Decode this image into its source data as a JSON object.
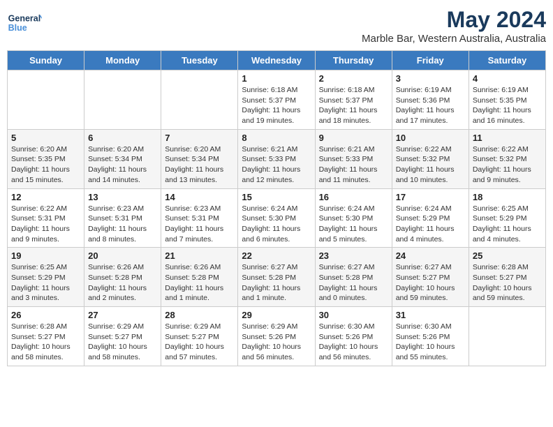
{
  "app": {
    "name_line1": "General",
    "name_line2": "Blue"
  },
  "title": {
    "month_year": "May 2024",
    "location": "Marble Bar, Western Australia, Australia"
  },
  "days_of_week": [
    "Sunday",
    "Monday",
    "Tuesday",
    "Wednesday",
    "Thursday",
    "Friday",
    "Saturday"
  ],
  "weeks": [
    [
      {
        "day": "",
        "text": ""
      },
      {
        "day": "",
        "text": ""
      },
      {
        "day": "",
        "text": ""
      },
      {
        "day": "1",
        "text": "Sunrise: 6:18 AM\nSunset: 5:37 PM\nDaylight: 11 hours and 19 minutes."
      },
      {
        "day": "2",
        "text": "Sunrise: 6:18 AM\nSunset: 5:37 PM\nDaylight: 11 hours and 18 minutes."
      },
      {
        "day": "3",
        "text": "Sunrise: 6:19 AM\nSunset: 5:36 PM\nDaylight: 11 hours and 17 minutes."
      },
      {
        "day": "4",
        "text": "Sunrise: 6:19 AM\nSunset: 5:35 PM\nDaylight: 11 hours and 16 minutes."
      }
    ],
    [
      {
        "day": "5",
        "text": "Sunrise: 6:20 AM\nSunset: 5:35 PM\nDaylight: 11 hours and 15 minutes."
      },
      {
        "day": "6",
        "text": "Sunrise: 6:20 AM\nSunset: 5:34 PM\nDaylight: 11 hours and 14 minutes."
      },
      {
        "day": "7",
        "text": "Sunrise: 6:20 AM\nSunset: 5:34 PM\nDaylight: 11 hours and 13 minutes."
      },
      {
        "day": "8",
        "text": "Sunrise: 6:21 AM\nSunset: 5:33 PM\nDaylight: 11 hours and 12 minutes."
      },
      {
        "day": "9",
        "text": "Sunrise: 6:21 AM\nSunset: 5:33 PM\nDaylight: 11 hours and 11 minutes."
      },
      {
        "day": "10",
        "text": "Sunrise: 6:22 AM\nSunset: 5:32 PM\nDaylight: 11 hours and 10 minutes."
      },
      {
        "day": "11",
        "text": "Sunrise: 6:22 AM\nSunset: 5:32 PM\nDaylight: 11 hours and 9 minutes."
      }
    ],
    [
      {
        "day": "12",
        "text": "Sunrise: 6:22 AM\nSunset: 5:31 PM\nDaylight: 11 hours and 9 minutes."
      },
      {
        "day": "13",
        "text": "Sunrise: 6:23 AM\nSunset: 5:31 PM\nDaylight: 11 hours and 8 minutes."
      },
      {
        "day": "14",
        "text": "Sunrise: 6:23 AM\nSunset: 5:31 PM\nDaylight: 11 hours and 7 minutes."
      },
      {
        "day": "15",
        "text": "Sunrise: 6:24 AM\nSunset: 5:30 PM\nDaylight: 11 hours and 6 minutes."
      },
      {
        "day": "16",
        "text": "Sunrise: 6:24 AM\nSunset: 5:30 PM\nDaylight: 11 hours and 5 minutes."
      },
      {
        "day": "17",
        "text": "Sunrise: 6:24 AM\nSunset: 5:29 PM\nDaylight: 11 hours and 4 minutes."
      },
      {
        "day": "18",
        "text": "Sunrise: 6:25 AM\nSunset: 5:29 PM\nDaylight: 11 hours and 4 minutes."
      }
    ],
    [
      {
        "day": "19",
        "text": "Sunrise: 6:25 AM\nSunset: 5:29 PM\nDaylight: 11 hours and 3 minutes."
      },
      {
        "day": "20",
        "text": "Sunrise: 6:26 AM\nSunset: 5:28 PM\nDaylight: 11 hours and 2 minutes."
      },
      {
        "day": "21",
        "text": "Sunrise: 6:26 AM\nSunset: 5:28 PM\nDaylight: 11 hours and 1 minute."
      },
      {
        "day": "22",
        "text": "Sunrise: 6:27 AM\nSunset: 5:28 PM\nDaylight: 11 hours and 1 minute."
      },
      {
        "day": "23",
        "text": "Sunrise: 6:27 AM\nSunset: 5:28 PM\nDaylight: 11 hours and 0 minutes."
      },
      {
        "day": "24",
        "text": "Sunrise: 6:27 AM\nSunset: 5:27 PM\nDaylight: 10 hours and 59 minutes."
      },
      {
        "day": "25",
        "text": "Sunrise: 6:28 AM\nSunset: 5:27 PM\nDaylight: 10 hours and 59 minutes."
      }
    ],
    [
      {
        "day": "26",
        "text": "Sunrise: 6:28 AM\nSunset: 5:27 PM\nDaylight: 10 hours and 58 minutes."
      },
      {
        "day": "27",
        "text": "Sunrise: 6:29 AM\nSunset: 5:27 PM\nDaylight: 10 hours and 58 minutes."
      },
      {
        "day": "28",
        "text": "Sunrise: 6:29 AM\nSunset: 5:27 PM\nDaylight: 10 hours and 57 minutes."
      },
      {
        "day": "29",
        "text": "Sunrise: 6:29 AM\nSunset: 5:26 PM\nDaylight: 10 hours and 56 minutes."
      },
      {
        "day": "30",
        "text": "Sunrise: 6:30 AM\nSunset: 5:26 PM\nDaylight: 10 hours and 56 minutes."
      },
      {
        "day": "31",
        "text": "Sunrise: 6:30 AM\nSunset: 5:26 PM\nDaylight: 10 hours and 55 minutes."
      },
      {
        "day": "",
        "text": ""
      }
    ]
  ]
}
